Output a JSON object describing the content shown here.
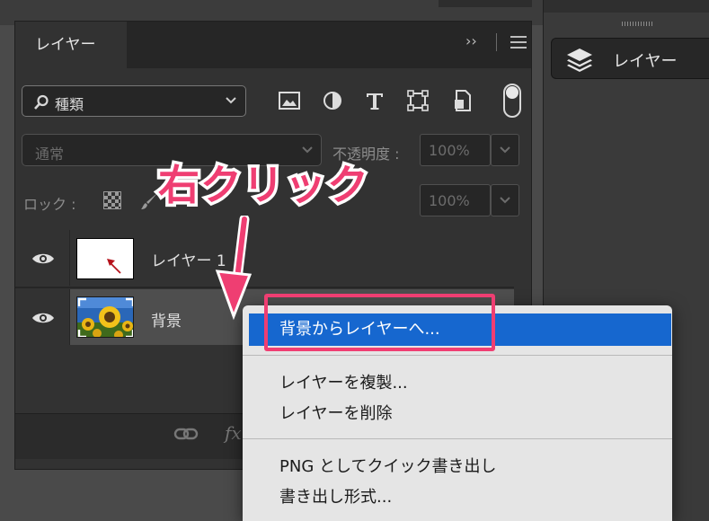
{
  "panel": {
    "tab_label": "レイヤー",
    "collapse_glyph": "››",
    "filter": {
      "label": "種類"
    },
    "blend_mode": "通常",
    "opacity_label": "不透明度 :",
    "opacity_value": "100%",
    "lock_label": "ロック :",
    "fill_value": "100%",
    "layers": [
      {
        "name": "レイヤー 1"
      },
      {
        "name": "背景"
      }
    ],
    "footer": {
      "fx_label": "fx"
    }
  },
  "dock": {
    "label": "レイヤー"
  },
  "context_menu": {
    "items": [
      "背景からレイヤーへ...",
      "レイヤーを複製...",
      "レイヤーを削除",
      "PNG としてクイック書き出し",
      "書き出し形式..."
    ],
    "selected_index": 0
  },
  "annotation": {
    "callout_text": "右クリック",
    "color": "#ef3e72"
  },
  "colors": {
    "menu_highlight": "#1667cf",
    "panel_bg": "#323232"
  }
}
